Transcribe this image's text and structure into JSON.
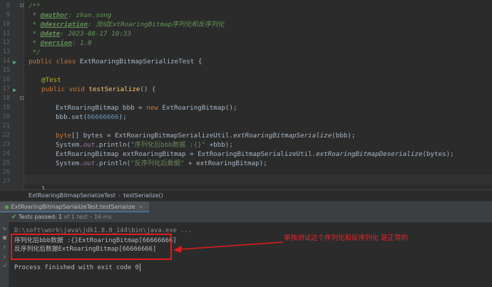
{
  "editor": {
    "line_numbers": [
      "8",
      "9",
      "10",
      "11",
      "12",
      "13",
      "14",
      "15",
      "16",
      "17",
      "18",
      "19",
      "20",
      "21",
      "22",
      "23",
      "24",
      "25",
      "26",
      "27"
    ],
    "javadoc": {
      "open": "/**",
      "author_tag": "@author",
      "author_val": ": zhan.song",
      "desc_tag": "@description",
      "desc_val": ": 测试ExtRoaringBitmap序列化和反序列化",
      "date_tag": "@date",
      "date_val": ": 2023-08-17 10:33",
      "version_tag": "@version",
      "version_val": ": 1.0",
      "close": " */"
    },
    "class_decl": {
      "kw": "public class ",
      "name": "ExtRoaringBitmapSerializeTest",
      "brace": " {"
    },
    "annotation": "@Test",
    "method_decl": {
      "kw": "public void ",
      "name": "testSerialize",
      "rest": "() {"
    },
    "line_new": {
      "a": "ExtRoaringBitmap bbb = ",
      "kw": "new",
      "b": " ExtRoaringBitmap();"
    },
    "line_set": {
      "a": "bbb.set(",
      "num": "66666666",
      "b": ");"
    },
    "line_bytes": {
      "kw": "byte",
      "a": "[] bytes = ExtRoaringBitmapSerializeUtil.",
      "m": "extRoaringBitmapSerialize",
      "b": "(bbb);"
    },
    "line_print1": {
      "a": "System.",
      "f": "out",
      "b": ".println(",
      "s": "\"序列化后bbb数据 :{}\"",
      "c": " +bbb);"
    },
    "line_deser": {
      "a": "ExtRoaringBitmap extRoaringBitmap = ExtRoaringBitmapSerializeUtil.",
      "m": "extRoaringBitmapDeserialize",
      "b": "(bytes);"
    },
    "line_print2": {
      "a": "System.",
      "f": "out",
      "b": ".println(",
      "s": "\"反序列化后数据\"",
      "c": " + extRoaringBitmap);"
    },
    "line_close": "}"
  },
  "breadcrumb": {
    "class_name": "ExtRoaringBitmapSerializeTest",
    "separator": "›",
    "method_name": "testSerialize()"
  },
  "run_tab": {
    "label": "ExtRoaringBitmapSerializeTest.testSerialize",
    "close": "×"
  },
  "run_status": {
    "prefix": "Tests passed:",
    "count": "1",
    "rest": "of 1 test – 16 ms"
  },
  "console": {
    "cmd": "D:\\soft\\work\\java\\jdk1.8.0_144\\bin\\java.exe ...",
    "out1": "序列化后bbb数据 :{}ExtRoaringBitmap[66666666]",
    "out2": "反序列化后数据ExtRoaringBitmap[66666666]",
    "exit": "Process finished with exit code 0"
  },
  "annotation_text": "单独测试这个序列化和反序列化 是正常的",
  "colors": {
    "annotation_red": "#e01b1b",
    "keyword": "#cc7832",
    "string": "#6a8759",
    "number": "#6897bb",
    "method": "#ffc66d",
    "javadoc": "#629755"
  },
  "icons": [
    "run-test-icon",
    "run-test-icon",
    "check-icon",
    "rerun-icon",
    "stop-icon",
    "arrow-up-icon",
    "arrow-down-icon",
    "wrap-icon"
  ]
}
